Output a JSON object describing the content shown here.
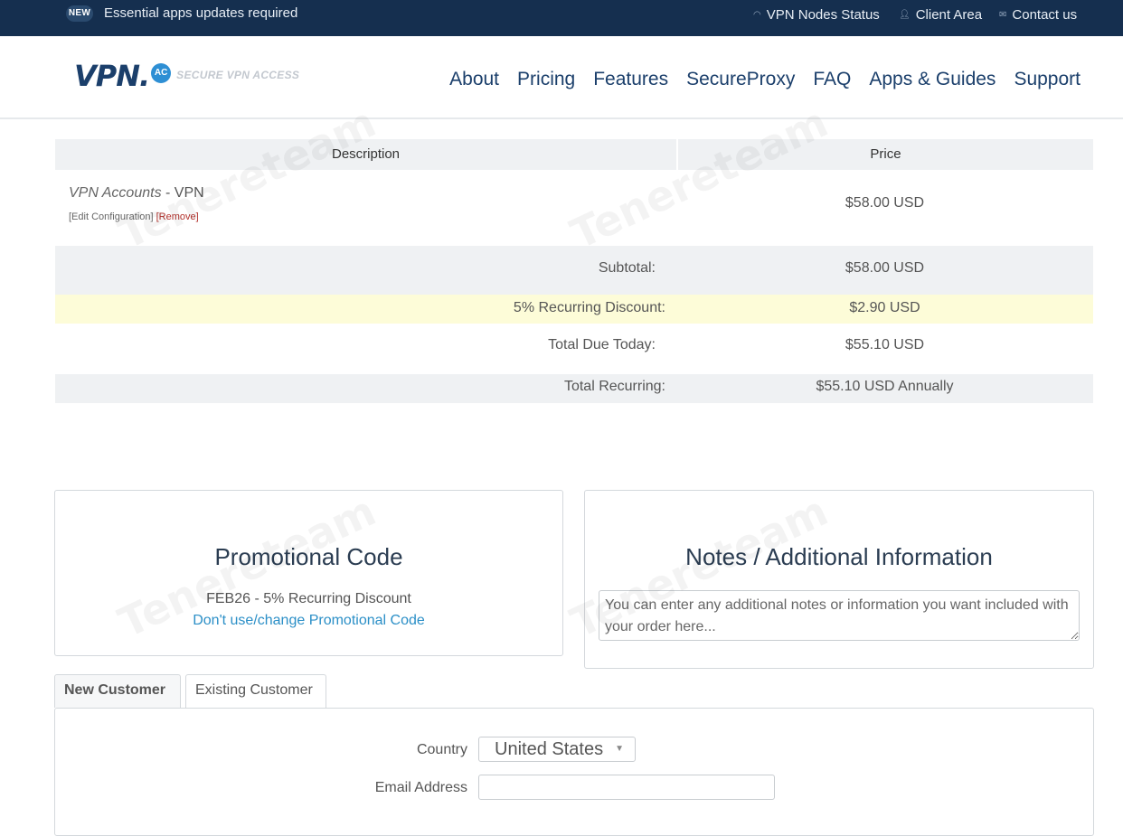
{
  "topbar": {
    "badge": "NEW",
    "notice": "Essential apps updates required",
    "links": {
      "nodes_status": "VPN Nodes Status",
      "client_area": "Client Area",
      "contact": "Contact us"
    }
  },
  "header": {
    "logo": {
      "main": "VPN.",
      "badge": "AC",
      "tagline": "SECURE VPN ACCESS"
    },
    "nav": [
      "About",
      "Pricing",
      "Features",
      "SecureProxy",
      "FAQ",
      "Apps & Guides",
      "Support"
    ]
  },
  "summary": {
    "columns": {
      "description": "Description",
      "price": "Price"
    },
    "item": {
      "category": "VPN Accounts",
      "name": " - VPN",
      "edit_link": "[Edit Configuration]",
      "remove_link": "[Remove]",
      "price": "$58.00 USD"
    },
    "subtotal": {
      "label": "Subtotal:",
      "value": "$58.00 USD"
    },
    "discount": {
      "label": "5% Recurring Discount:",
      "value": "$2.90 USD"
    },
    "total_due": {
      "label": "Total Due Today:",
      "value": "$55.10 USD"
    },
    "total_recurring": {
      "label": "Total Recurring:",
      "value": "$55.10 USD Annually"
    }
  },
  "promo": {
    "title": "Promotional Code",
    "applied": "FEB26 - 5% Recurring Discount",
    "change_link": "Don't use/change Promotional Code"
  },
  "notes": {
    "title": "Notes / Additional Information",
    "placeholder": "You can enter any additional notes or information you want included with your order here..."
  },
  "tabs": {
    "new_customer": "New Customer",
    "existing_customer": "Existing Customer"
  },
  "form": {
    "country_label": "Country",
    "country_value": "United States",
    "email_label": "Email Address"
  },
  "watermark": "Tenereteam"
}
